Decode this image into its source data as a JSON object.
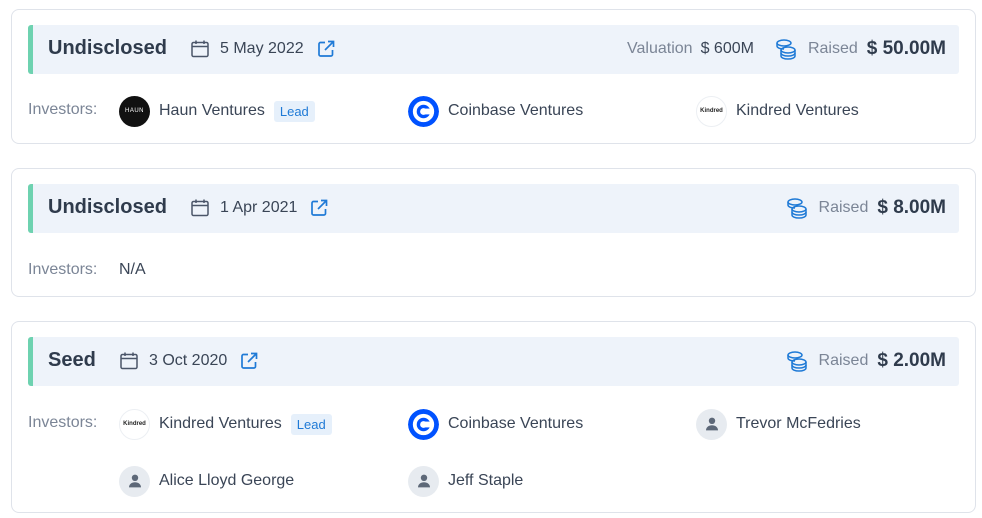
{
  "investors_label": "Investors:",
  "rounds": [
    {
      "type": "Undisclosed",
      "date": "5 May 2022",
      "valuation_label": "Valuation",
      "valuation_value": "$ 600M",
      "raised_label": "Raised",
      "raised_value": "$ 50.00M",
      "investors": [
        {
          "name": "Haun Ventures",
          "logo": "haun-logo",
          "logo_text": "HAUN",
          "lead": "Lead"
        },
        {
          "name": "Coinbase Ventures",
          "logo": "coinbase-logo"
        },
        {
          "name": "Kindred Ventures",
          "logo": "kindred-logo",
          "logo_text": "Kindred"
        }
      ]
    },
    {
      "type": "Undisclosed",
      "date": "1 Apr 2021",
      "raised_label": "Raised",
      "raised_value": "$ 8.00M",
      "investors_na": "N/A"
    },
    {
      "type": "Seed",
      "date": "3 Oct 2020",
      "raised_label": "Raised",
      "raised_value": "$ 2.00M",
      "investors": [
        {
          "name": "Kindred Ventures",
          "logo": "kindred-logo",
          "logo_text": "Kindred",
          "lead": "Lead"
        },
        {
          "name": "Coinbase Ventures",
          "logo": "coinbase-logo"
        },
        {
          "name": "Trevor McFedries",
          "logo": "person-icon"
        },
        {
          "name": "Alice Lloyd George",
          "logo": "person-icon"
        },
        {
          "name": "Jeff Staple",
          "logo": "person-icon"
        }
      ]
    }
  ],
  "colors": {
    "accent_bar": "#6ed2b0",
    "header_bg": "#eef3fa",
    "link_blue": "#1f7ad6",
    "coinbase_blue": "#0052ff"
  }
}
